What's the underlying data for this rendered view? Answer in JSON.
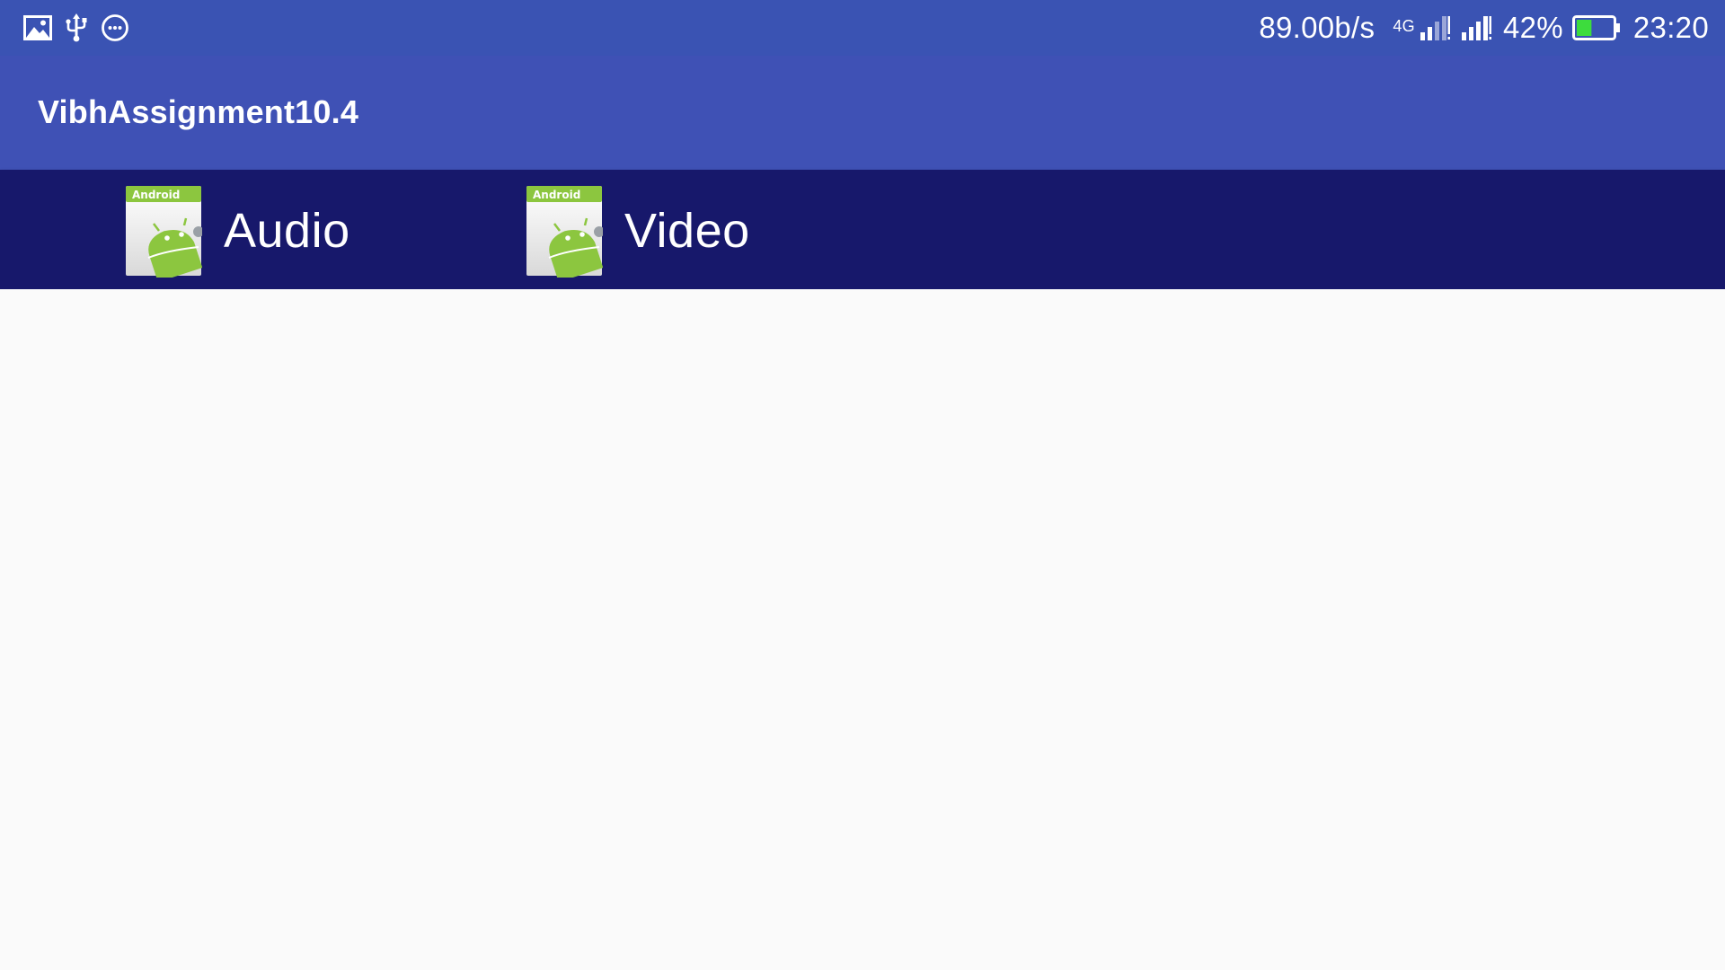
{
  "status_bar": {
    "left_icons": [
      "image-icon",
      "usb-icon",
      "more-circle-icon"
    ],
    "net_speed": "89.00b/s",
    "network_type": "4G",
    "battery_percent": "42%",
    "battery_level": 0.42,
    "time": "23:20",
    "background_color": "#3a53b3"
  },
  "app_bar": {
    "title": "VibhAssignment10.4",
    "background_color": "#3f51b5"
  },
  "tabs": {
    "background_color": "#17186b",
    "items": [
      {
        "label": "Audio",
        "icon": "android-app-icon",
        "icon_text": "Android"
      },
      {
        "label": "Video",
        "icon": "android-app-icon",
        "icon_text": "Android"
      }
    ]
  }
}
